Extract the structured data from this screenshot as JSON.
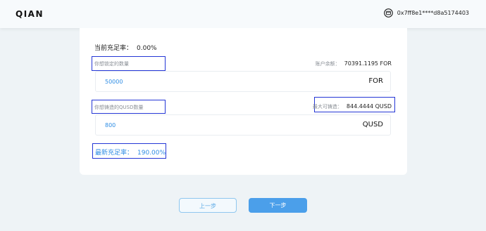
{
  "header": {
    "logo": "QIAN",
    "wallet_address": "0x7ff8e1****d8a5174403"
  },
  "form": {
    "current_rate_label": "当前充足率：",
    "current_rate_value": "0.00%",
    "lock_label": "你想锁定的数量",
    "balance_label": "账户余额：",
    "balance_value": "70391.1195 FOR",
    "lock_amount": "50000",
    "lock_unit": "FOR",
    "mint_label": "你想铸造的QUSD数量",
    "max_mint_label": "最大可铸造：",
    "max_mint_value": "844.4444 QUSD",
    "mint_amount": "800",
    "mint_unit": "QUSD",
    "new_rate_label": "最新充足率：",
    "new_rate_value": "190.00%"
  },
  "buttons": {
    "prev": "上一步",
    "next": "下一步"
  },
  "colors": {
    "accent": "#2f8de4",
    "highlight_box": "#2436d6",
    "background": "#eef3f6"
  }
}
